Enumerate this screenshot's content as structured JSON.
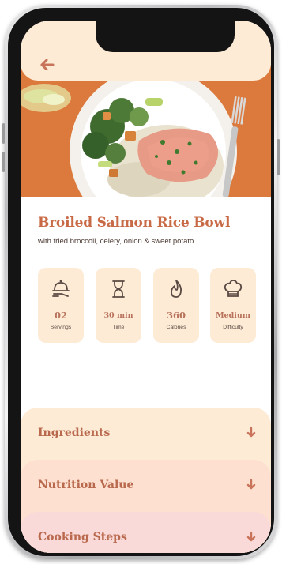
{
  "recipe": {
    "title": "Broiled Salmon Rice Bowl",
    "subtitle": "with fried broccoli, celery, onion & sweet potato"
  },
  "stats": [
    {
      "icon": "serving-dish-icon",
      "value": "02",
      "label": "Servings"
    },
    {
      "icon": "hourglass-icon",
      "value": "30 min",
      "label": "Time"
    },
    {
      "icon": "flame-icon",
      "value": "360",
      "label": "Calories"
    },
    {
      "icon": "chef-hat-icon",
      "value": "Medium",
      "label": "Difficulty"
    }
  ],
  "sections": [
    {
      "label": "Ingredients",
      "color": "#fdebd6"
    },
    {
      "label": "Nutrition Value",
      "color": "#fde0cf"
    },
    {
      "label": "Cooking Steps",
      "color": "#fadad8"
    }
  ],
  "colors": {
    "accent": "#c96a47",
    "card": "#fdebd6",
    "hero_background": "#dc7a3d"
  }
}
